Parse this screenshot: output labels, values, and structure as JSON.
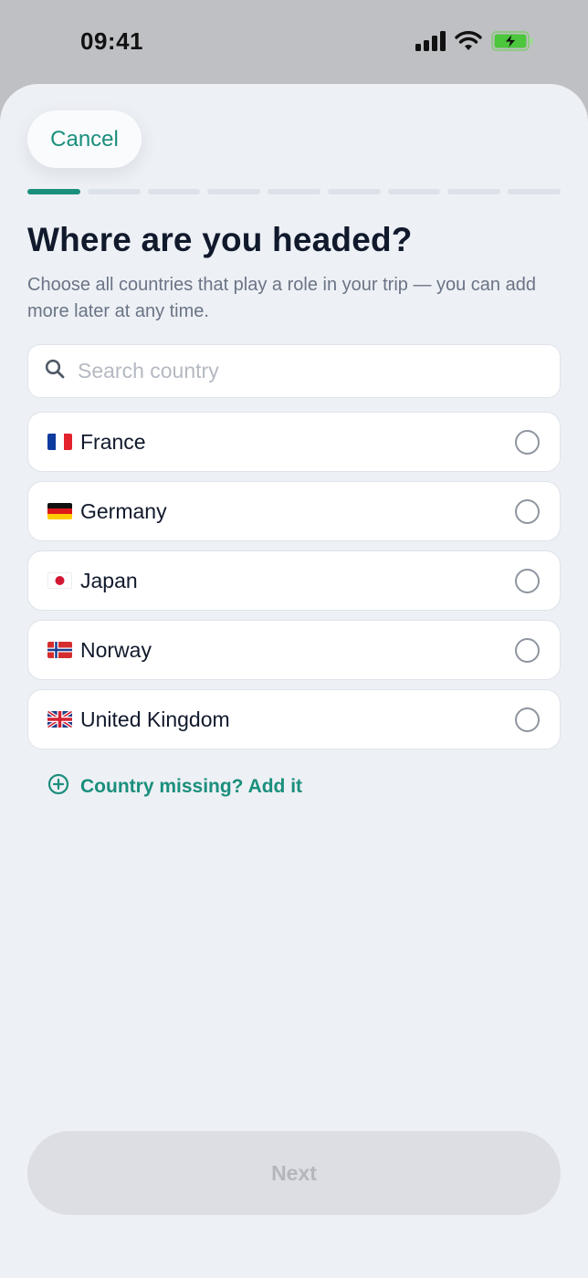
{
  "status_bar": {
    "time": "09:41",
    "icons": [
      "cellular-signal-icon",
      "wifi-icon",
      "battery-charging-icon"
    ]
  },
  "header": {
    "cancel_label": "Cancel",
    "progress": {
      "current_step": 1,
      "total_steps": 9
    }
  },
  "main": {
    "title": "Where are you headed?",
    "subtitle": "Choose all countries that play a role in your trip — you can add more later at any time.",
    "search": {
      "placeholder": "Search country",
      "value": ""
    },
    "countries": [
      {
        "name": "France",
        "flag": "flag-fr",
        "selected": false
      },
      {
        "name": "Germany",
        "flag": "flag-de",
        "selected": false
      },
      {
        "name": "Japan",
        "flag": "flag-jp",
        "selected": false
      },
      {
        "name": "Norway",
        "flag": "flag-no",
        "selected": false
      },
      {
        "name": "United Kingdom",
        "flag": "flag-gb",
        "selected": false
      }
    ],
    "add_country_label": "Country missing? Add it"
  },
  "footer": {
    "next_label": "Next",
    "next_enabled": false
  },
  "colors": {
    "accent": "#1a8f7c",
    "background": "#edf0f5",
    "title": "#111a2c",
    "subtitle": "#6a7485",
    "disabled_button": "#dcdee3"
  }
}
